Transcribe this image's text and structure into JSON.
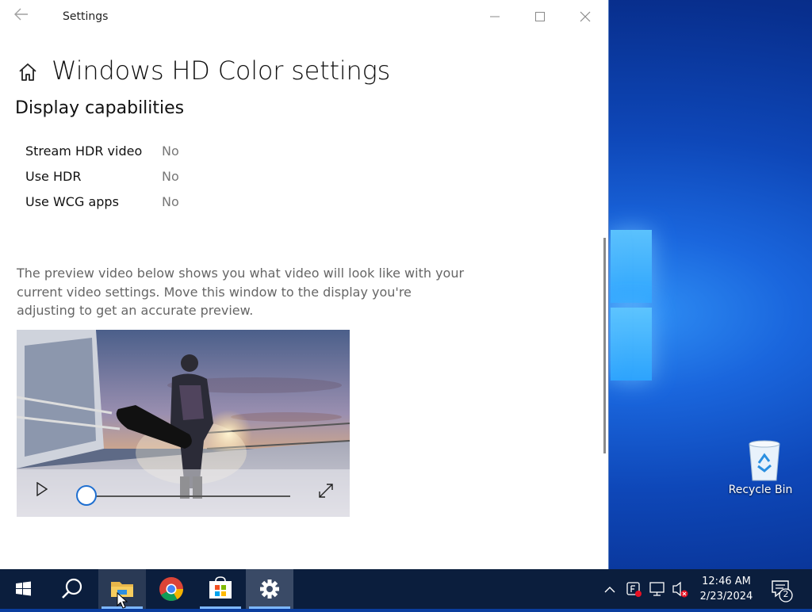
{
  "window": {
    "title": "Settings",
    "page_title": "Windows HD Color settings",
    "section_title": "Display capabilities",
    "capabilities": [
      {
        "label": "Stream HDR video",
        "value": "No"
      },
      {
        "label": "Use HDR",
        "value": "No"
      },
      {
        "label": "Use WCG apps",
        "value": "No"
      }
    ],
    "description": "The preview video below shows you what video will look like with your current video settings. Move this window to the display you're adjusting to get an accurate preview.",
    "video": {
      "progress": 0
    }
  },
  "desktop": {
    "recycle_bin_label": "Recycle Bin"
  },
  "taskbar": {
    "time": "12:46 AM",
    "date": "2/23/2024",
    "notification_count": "2",
    "pinned": [
      "start-icon",
      "search-icon",
      "file-explorer-icon",
      "chrome-icon",
      "store-icon",
      "settings-icon"
    ]
  },
  "colors": {
    "accent": "#1f6fd0",
    "taskbar": "#0b1e3d",
    "desktop": "#0e47b8"
  }
}
